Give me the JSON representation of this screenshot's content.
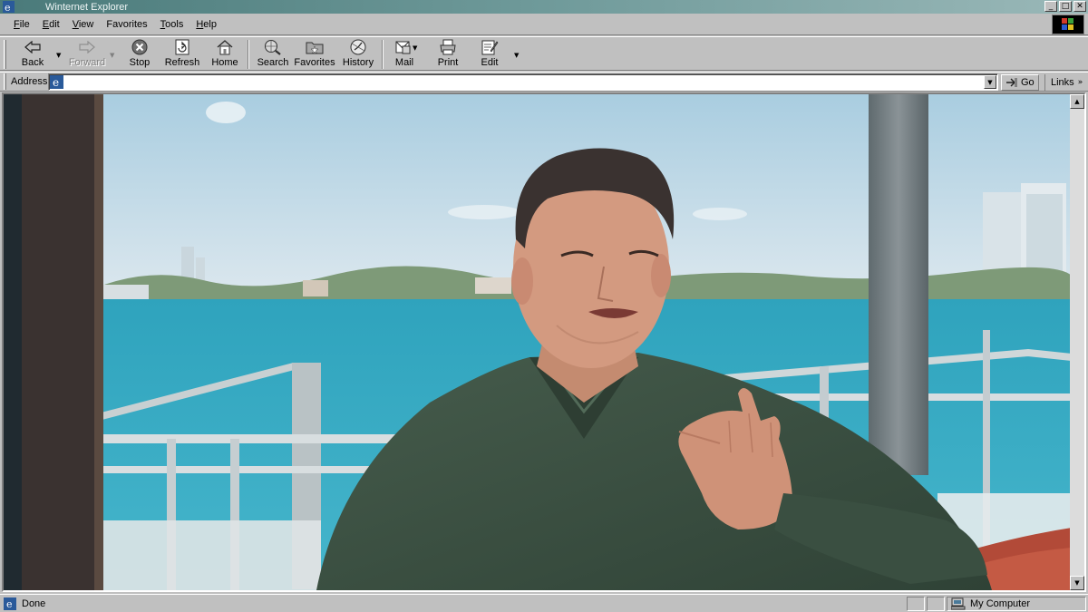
{
  "window": {
    "title": "Winternet Explorer"
  },
  "menu": {
    "items": [
      {
        "key": "F",
        "rest": "ile"
      },
      {
        "key": "E",
        "rest": "dit"
      },
      {
        "key": "V",
        "rest": "iew"
      },
      {
        "key": "F",
        "rest": "avorites"
      },
      {
        "key": "T",
        "rest": "ools"
      },
      {
        "key": "H",
        "rest": "elp"
      }
    ]
  },
  "toolbar": {
    "back": "Back",
    "forward": "Forward",
    "stop": "Stop",
    "refresh": "Refresh",
    "home": "Home",
    "search": "Search",
    "favorites": "Favorites",
    "history": "History",
    "mail": "Mail",
    "print": "Print",
    "edit": "Edit"
  },
  "address": {
    "label": "Address",
    "value": "",
    "go": "Go",
    "links": "Links"
  },
  "status": {
    "text": "Done",
    "zone": "My Computer"
  },
  "colors": {
    "chrome": "#c0c0c0",
    "title_gradient_start": "#4a7a7a",
    "water": "#3fb0c9",
    "sky": "#c5dbe8",
    "shirt": "#3f5446"
  }
}
